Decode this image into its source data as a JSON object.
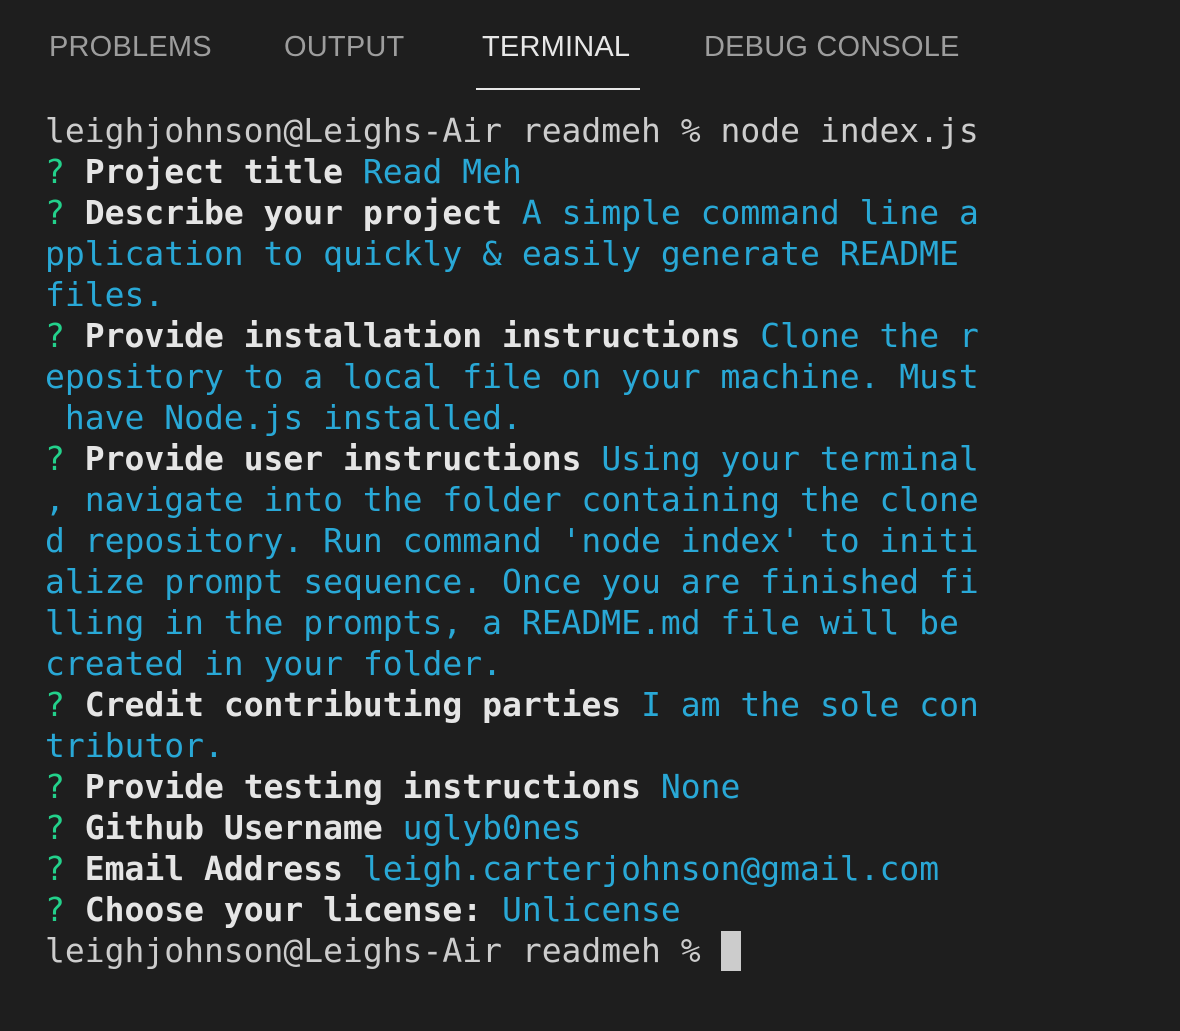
{
  "tabs": [
    {
      "label": "PROBLEMS",
      "active": false
    },
    {
      "label": "OUTPUT",
      "active": false
    },
    {
      "label": "TERMINAL",
      "active": true
    },
    {
      "label": "DEBUG CONSOLE",
      "active": false
    }
  ],
  "terminal": {
    "command_line": "leighjohnson@Leighs-Air readmeh % node index.js",
    "prompt_marker": "? ",
    "qa": [
      {
        "question": "Project title",
        "answer_lines": [
          "Read Meh"
        ]
      },
      {
        "question": "Describe your project",
        "answer_lines": [
          "A simple command line a",
          "pplication to quickly & easily generate README",
          "files."
        ]
      },
      {
        "question": "Provide installation instructions",
        "answer_lines": [
          "Clone the r",
          "epository to a local file on your machine. Must",
          " have Node.js installed."
        ]
      },
      {
        "question": "Provide user instructions",
        "answer_lines": [
          "Using your terminal",
          ", navigate into the folder containing the clone",
          "d repository. Run command 'node index' to initi",
          "alize prompt sequence. Once you are finished fi",
          "lling in the prompts, a README.md file will be",
          "created in your folder."
        ]
      },
      {
        "question": "Credit contributing parties",
        "answer_lines": [
          "I am the sole con",
          "tributor."
        ]
      },
      {
        "question": "Provide testing instructions",
        "answer_lines": [
          "None"
        ]
      },
      {
        "question": "Github Username",
        "answer_lines": [
          "uglyb0nes"
        ]
      },
      {
        "question": "Email Address",
        "answer_lines": [
          "leigh.carterjohnson@gmail.com"
        ]
      },
      {
        "question": "Choose your license:",
        "answer_lines": [
          "Unlicense"
        ]
      }
    ],
    "final_prompt": "leighjohnson@Leighs-Air readmeh % ",
    "colors": {
      "background": "#1e1e1e",
      "prompt_marker": "#23d18b",
      "question": "#e5e5e5",
      "answer": "#29a8d6",
      "plain": "#cccccc"
    }
  }
}
